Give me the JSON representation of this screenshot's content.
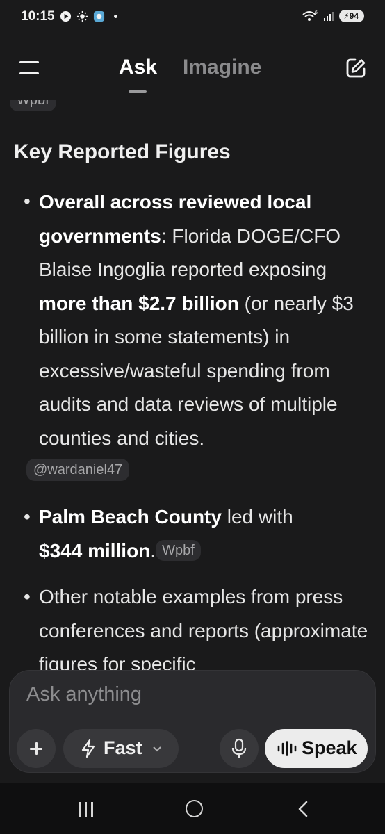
{
  "status_bar": {
    "time": "10:15",
    "battery": "94",
    "icons": [
      "media-icon",
      "brightness-icon",
      "app-icon",
      "dot-icon",
      "wifi-icon",
      "signal-icon"
    ]
  },
  "header": {
    "tabs": [
      {
        "label": "Ask",
        "active": true
      },
      {
        "label": "Imagine",
        "active": false
      }
    ]
  },
  "content": {
    "top_chip": "Wpbf",
    "section_title": "Key Reported Figures",
    "bullets": [
      {
        "bold1": "Overall across reviewed local governments",
        "text1": ": Florida DOGE/CFO Blaise Ingoglia reported exposing ",
        "bold2": "more than $2.7 billion",
        "text2": " (or nearly $3 billion in some statements) in excessive/wasteful spending from audits and data reviews of multiple counties and cities.",
        "chip": "@wardaniel47"
      },
      {
        "bold1": "Palm Beach County",
        "text1": " led with ",
        "bold2": "$344 million",
        "text2": ".",
        "chip": "Wpbf"
      },
      {
        "text1": "Other notable examples from press conferences and reports (approximate figures for specific"
      }
    ]
  },
  "composer": {
    "placeholder": "Ask anything",
    "mode_label": "Fast",
    "speak_label": "Speak"
  },
  "colors": {
    "background": "#1a1a1b",
    "composer": "#2a2a2d",
    "chip": "#2d2d30",
    "speak_button": "#ececec"
  }
}
